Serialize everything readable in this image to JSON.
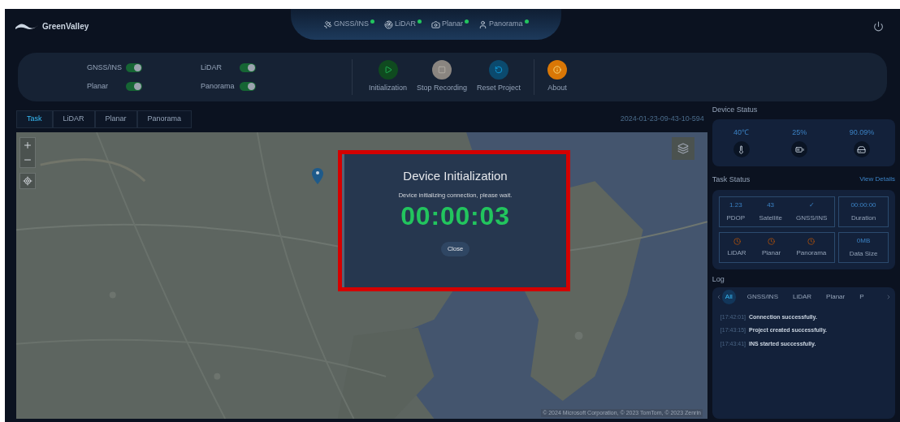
{
  "logo": {
    "text": "GreenValley"
  },
  "header_status": [
    {
      "label": "GNSS/INS",
      "kind": "satellite",
      "on": true
    },
    {
      "label": "LiDAR",
      "kind": "lidar",
      "on": true
    },
    {
      "label": "Planar",
      "kind": "camera",
      "on": true
    },
    {
      "label": "Panorama",
      "kind": "pano",
      "on": true
    }
  ],
  "toggles": [
    {
      "label": "GNSS/INS",
      "on": true
    },
    {
      "label": "LiDAR",
      "on": true
    },
    {
      "label": "Planar",
      "on": true
    },
    {
      "label": "Panorama",
      "on": true
    }
  ],
  "actions": [
    {
      "label": "Initialization",
      "kind": "init"
    },
    {
      "label": "Stop Recording",
      "kind": "stop"
    },
    {
      "label": "Reset Project",
      "kind": "reset"
    },
    {
      "label": "About",
      "kind": "about"
    }
  ],
  "map_tabs": [
    {
      "label": "Task",
      "selected": true
    },
    {
      "label": "LiDAR",
      "selected": false
    },
    {
      "label": "Planar",
      "selected": false
    },
    {
      "label": "Panorama",
      "selected": false
    }
  ],
  "timestamp": "2024-01-23-09-43-10-594",
  "map": {
    "attribution": "© 2024 Microsoft Corporation, © 2023 TomTom, © 2023 Zenrin"
  },
  "dialog": {
    "title": "Device Initialization",
    "message": "Device initializing connection, please wait.",
    "timer": "00:00:03",
    "button": "Close"
  },
  "device_status": {
    "title": "Device Status",
    "items": [
      {
        "value": "40℃",
        "kind": "temperature"
      },
      {
        "value": "25%",
        "kind": "battery"
      },
      {
        "value": "90.09%",
        "kind": "storage"
      }
    ]
  },
  "task_status": {
    "title": "Task Status",
    "link": "View Details",
    "metrics": [
      {
        "value": "1.23",
        "label": "PDOP"
      },
      {
        "value": "43",
        "label": "Satellite"
      },
      {
        "value": "✓",
        "label": "GNSS/INS"
      }
    ],
    "duration": {
      "value": "00:00:00",
      "label": "Duration"
    },
    "sensors": [
      {
        "label": "LiDAR"
      },
      {
        "label": "Planar"
      },
      {
        "label": "Panorama"
      }
    ],
    "data_size": {
      "value": "0MB",
      "label": "Data Size"
    }
  },
  "log": {
    "title": "Log",
    "tabs": [
      {
        "label": "All",
        "selected": true
      },
      {
        "label": "GNSS/INS",
        "selected": false
      },
      {
        "label": "LiDAR",
        "selected": false
      },
      {
        "label": "Planar",
        "selected": false
      },
      {
        "label": "P",
        "selected": false
      }
    ],
    "entries": [
      {
        "time": "[17:42:01]",
        "message": "Connection successfully."
      },
      {
        "time": "[17:43:15]",
        "message": "Project created successfully."
      },
      {
        "time": "[17:43:41]",
        "message": "INS started successfully."
      }
    ]
  }
}
